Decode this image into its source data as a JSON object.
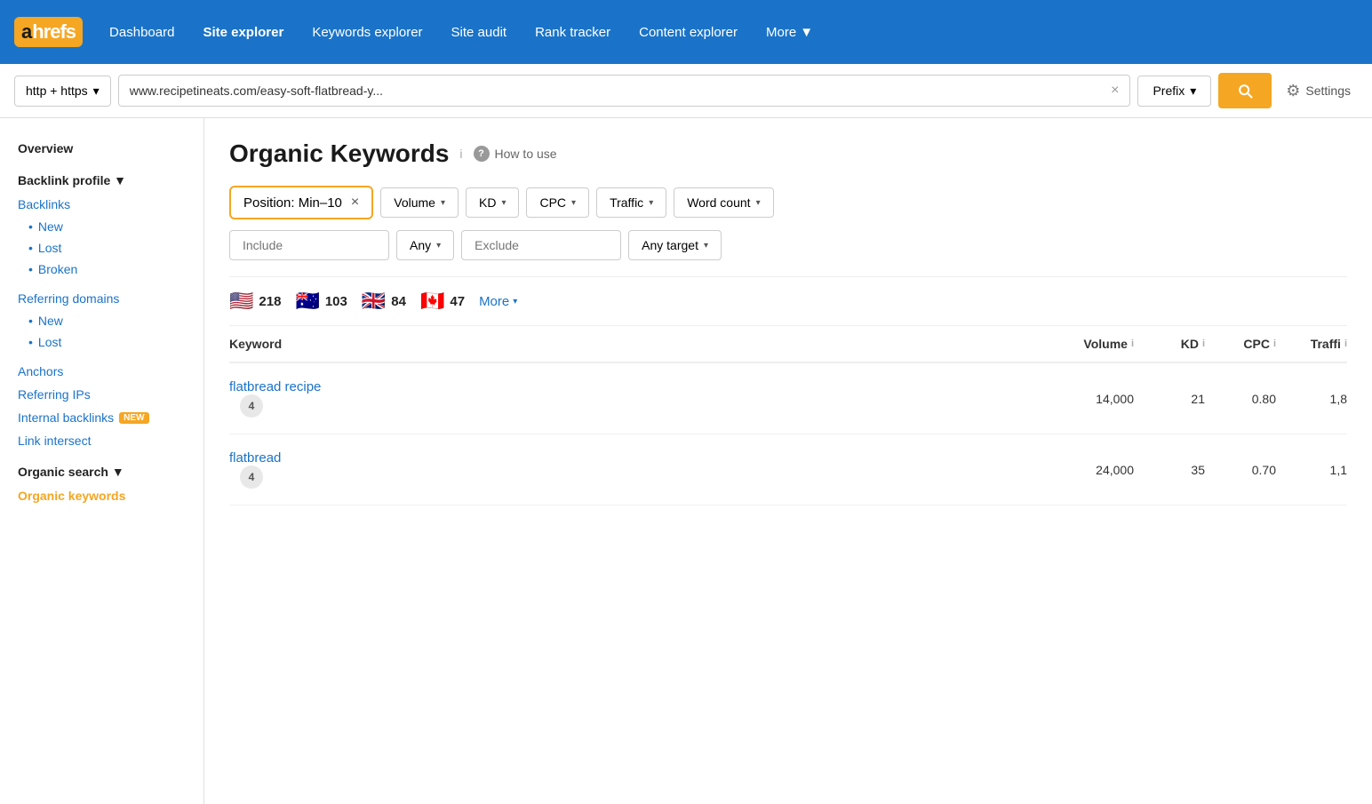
{
  "logo": {
    "a_letter": "a",
    "hrefs_text": "hrefs"
  },
  "nav": {
    "links": [
      {
        "label": "Dashboard",
        "active": false
      },
      {
        "label": "Site explorer",
        "active": true
      },
      {
        "label": "Keywords explorer",
        "active": false
      },
      {
        "label": "Site audit",
        "active": false
      },
      {
        "label": "Rank tracker",
        "active": false
      },
      {
        "label": "Content explorer",
        "active": false
      }
    ],
    "more_label": "More"
  },
  "search_bar": {
    "protocol_label": "http + https",
    "url_value": "www.recipetineats.com/easy-soft-flatbread-y...",
    "clear_label": "×",
    "mode_label": "Prefix",
    "search_icon": "search",
    "settings_label": "Settings",
    "gear_icon": "gear"
  },
  "sidebar": {
    "overview_label": "Overview",
    "backlink_profile_label": "Backlink profile ▼",
    "backlinks_label": "Backlinks",
    "backlinks_sub": [
      "New",
      "Lost",
      "Broken"
    ],
    "referring_domains_label": "Referring domains",
    "referring_domains_sub": [
      "New",
      "Lost"
    ],
    "anchors_label": "Anchors",
    "referring_ips_label": "Referring IPs",
    "internal_backlinks_label": "Internal backlinks",
    "internal_backlinks_badge": "NEW",
    "link_intersect_label": "Link intersect",
    "organic_search_label": "Organic search ▼",
    "organic_keywords_label": "Organic keywords"
  },
  "content": {
    "page_title": "Organic Keywords",
    "how_to_use_label": "How to use",
    "info_icon": "i",
    "question_icon": "?",
    "filters": {
      "position_filter": "Position: Min–10",
      "position_close": "×",
      "volume_label": "Volume",
      "kd_label": "KD",
      "cpc_label": "CPC",
      "traffic_label": "Traffic",
      "word_count_label": "Word count"
    },
    "filter_row2": {
      "include_placeholder": "Include",
      "any_label": "Any",
      "exclude_placeholder": "Exclude",
      "any_target_label": "Any target"
    },
    "flags": [
      {
        "emoji": "🇺🇸",
        "count": "218",
        "country": "us"
      },
      {
        "emoji": "🇦🇺",
        "count": "103",
        "country": "au"
      },
      {
        "emoji": "🇬🇧",
        "count": "84",
        "country": "gb"
      },
      {
        "emoji": "🇨🇦",
        "count": "47",
        "country": "ca"
      }
    ],
    "more_label": "More",
    "table": {
      "headers": {
        "keyword": "Keyword",
        "volume": "Volume",
        "kd": "KD",
        "cpc": "CPC",
        "traffic": "Traffi"
      },
      "rows": [
        {
          "keyword": "flatbread recipe",
          "position": "4",
          "volume": "14,000",
          "kd": "21",
          "cpc": "0.80",
          "traffic": "1,8"
        },
        {
          "keyword": "flatbread",
          "position": "4",
          "volume": "24,000",
          "kd": "35",
          "cpc": "0.70",
          "traffic": "1,1"
        }
      ]
    }
  }
}
